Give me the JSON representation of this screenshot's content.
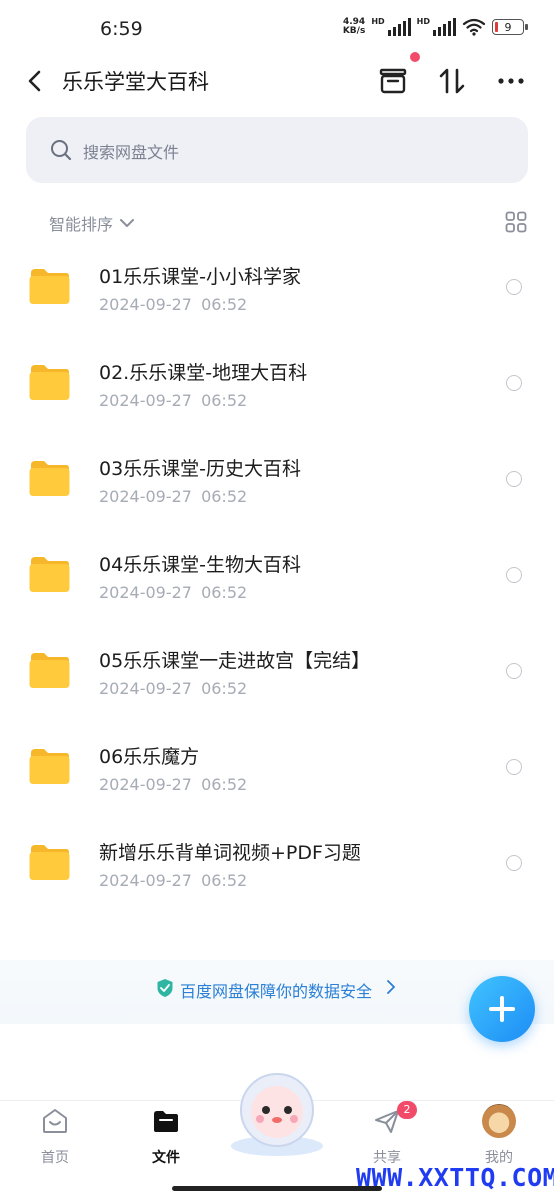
{
  "status_bar": {
    "time": "6:59",
    "net_speed_value": "4.94",
    "net_speed_unit": "KB/s",
    "hd1": "HD",
    "hd2": "HD",
    "battery": "9"
  },
  "header": {
    "title": "乐乐学堂大百科",
    "icons": [
      "back-arrow-icon",
      "archive-box-icon",
      "transfer-icon",
      "more-icon"
    ]
  },
  "search": {
    "placeholder": "搜索网盘文件"
  },
  "sort": {
    "label": "智能排序"
  },
  "files": [
    {
      "name": "01乐乐课堂-小小科学家",
      "date": "2024-09-27 06:52"
    },
    {
      "name": "02.乐乐课堂-地理大百科",
      "date": "2024-09-27 06:52"
    },
    {
      "name": "03乐乐课堂-历史大百科",
      "date": "2024-09-27 06:52"
    },
    {
      "name": "04乐乐课堂-生物大百科",
      "date": "2024-09-27 06:52"
    },
    {
      "name": "05乐乐课堂一走进故宫【完结】",
      "date": "2024-09-27 06:52"
    },
    {
      "name": "06乐乐魔方",
      "date": "2024-09-27 06:52"
    },
    {
      "name": "新增乐乐背单词视频+PDF习题",
      "date": "2024-09-27 06:52"
    }
  ],
  "banner": {
    "text": "百度网盘保障你的数据安全"
  },
  "nav": {
    "home": "首页",
    "files": "文件",
    "share": "共享",
    "share_badge": "2",
    "mine": "我的"
  },
  "watermark": "WWW.XXTTQ.COM",
  "colors": {
    "accent": "#1d8cf5",
    "folder": "#ffc83d",
    "badge": "#f24b6a"
  }
}
